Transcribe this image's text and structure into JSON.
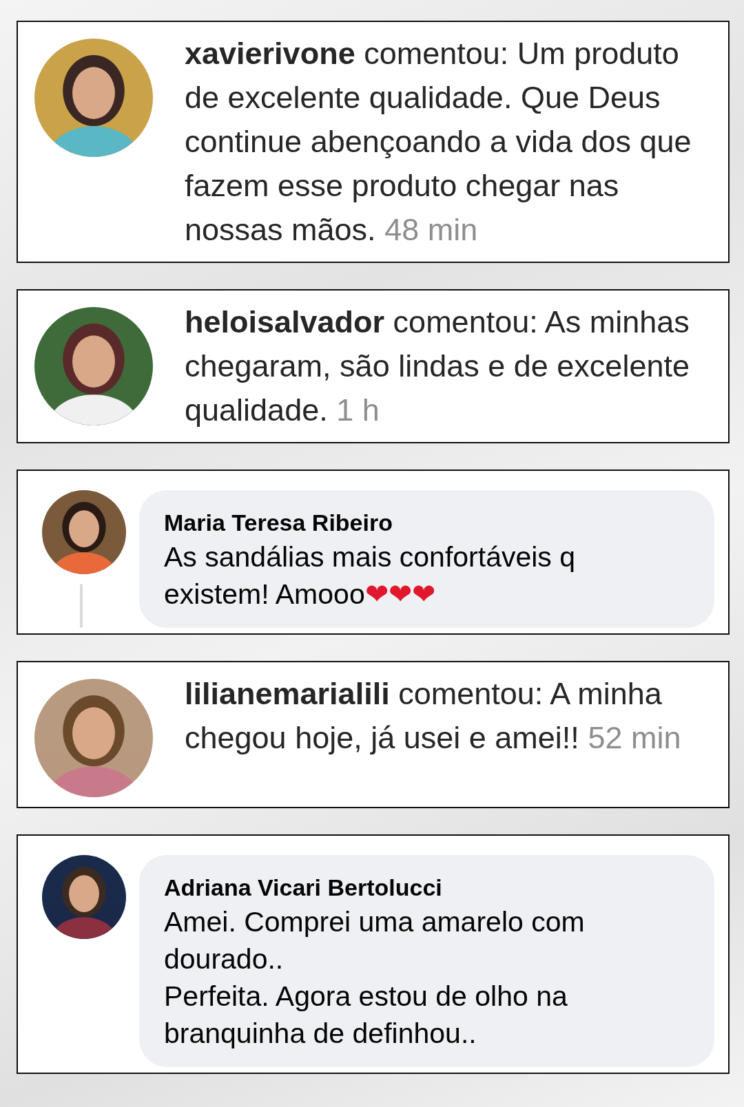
{
  "comments": [
    {
      "kind": "instagram",
      "author": "xavierivone",
      "verb": "comentou:",
      "text": "Um produto de excelente qualidade. Que Deus continue abençoando a vida dos que fazem esse produto chegar nas nossas mãos.",
      "time": "48 min"
    },
    {
      "kind": "instagram",
      "author": "heloisalvador",
      "verb": "comentou:",
      "text": "As minhas chegaram, são lindas e de excelente qualidade.",
      "time": "1 h"
    },
    {
      "kind": "facebook",
      "author": "Maria Teresa Ribeiro",
      "text": "As sandálias mais confortáveis q existem! Amooo",
      "emoji": "❤❤❤",
      "thread": true
    },
    {
      "kind": "instagram",
      "author": "lilianemarialili",
      "verb": "comentou:",
      "text": "A minha chegou hoje, já usei e amei!!",
      "time": "52 min"
    },
    {
      "kind": "facebook",
      "author": "Adriana Vicari Bertolucci",
      "text": "Amei. Comprei uma amarelo com dourado..\nPerfeita. Agora estou de olho na branquinha de definhou..",
      "thread": false
    }
  ]
}
